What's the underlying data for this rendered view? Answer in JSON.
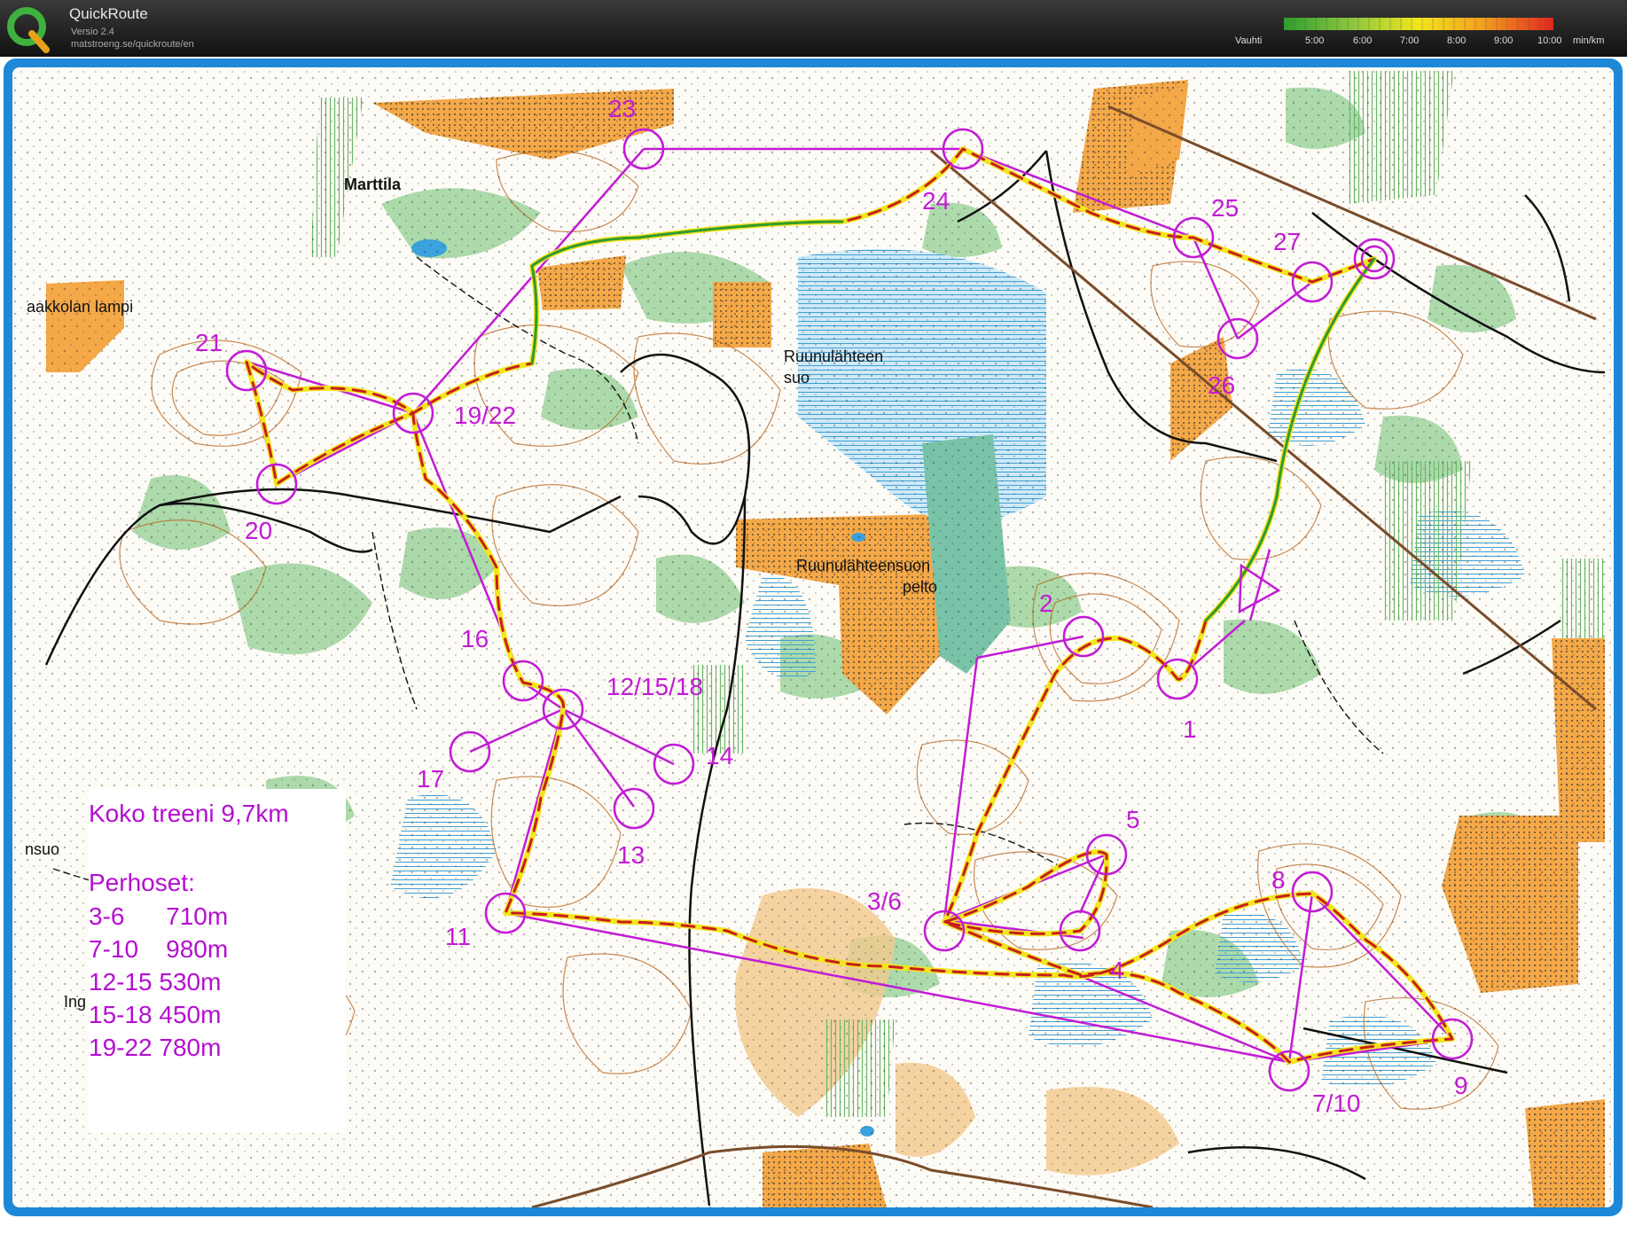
{
  "app": {
    "title": "QuickRoute",
    "version": "Versio 2.4",
    "url": "matstroeng.se/quickroute/en",
    "logo_letter": "Q"
  },
  "pace_legend": {
    "label": "Vauhti",
    "ticks": [
      "5:00",
      "6:00",
      "7:00",
      "8:00",
      "9:00",
      "10:00"
    ],
    "unit": "min/km",
    "colors": [
      "#2e9e2e",
      "#8cc63f",
      "#f2e61c",
      "#f39a1e",
      "#e0261e"
    ]
  },
  "map": {
    "place_names": [
      "Marttila",
      "aakkolan lampi",
      "Ruunulähteen",
      "suo",
      "Ruunulähteensuon",
      "pelto",
      "nsuo",
      "Ing"
    ],
    "control_labels": [
      "1",
      "2",
      "3/6",
      "4",
      "5",
      "7/10",
      "8",
      "9",
      "11",
      "12/15/18",
      "13",
      "14",
      "16",
      "17",
      "19/22",
      "20",
      "21",
      "23",
      "24",
      "25",
      "26",
      "27"
    ],
    "colors": {
      "control": "#c21bd6",
      "route": "#c81e1e",
      "open_land": "#f2a540",
      "vegetation": "#8ccb8c",
      "water": "#4aa8d8",
      "contour": "#b5651d"
    }
  },
  "info": {
    "title": "Koko treeni 9,7km",
    "subtitle": "Perhoset:",
    "rows": [
      "3-6      710m",
      "7-10    980m",
      "12-15 530m",
      "15-18 450m",
      "19-22 780m"
    ]
  }
}
